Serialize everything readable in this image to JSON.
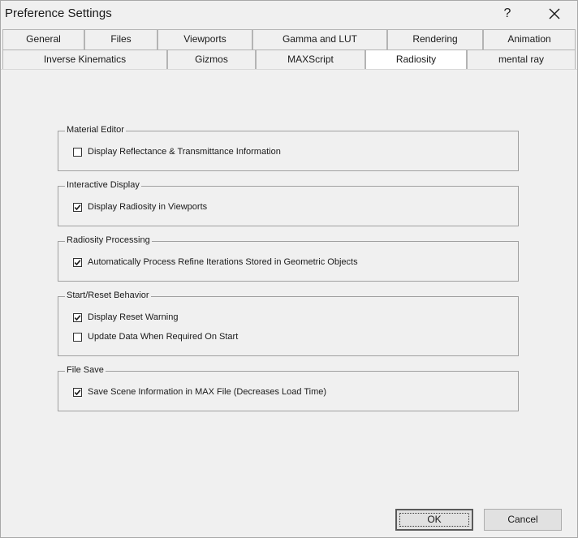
{
  "window": {
    "title": "Preference Settings",
    "help_label": "?"
  },
  "tabs": {
    "row1": [
      "General",
      "Files",
      "Viewports",
      "Gamma and LUT",
      "Rendering",
      "Animation"
    ],
    "row2": [
      "Inverse Kinematics",
      "Gizmos",
      "MAXScript",
      "Radiosity",
      "mental ray"
    ],
    "active": "Radiosity"
  },
  "groups": {
    "material_editor": {
      "label": "Material Editor",
      "options": [
        {
          "label": "Display Reflectance & Transmittance Information",
          "checked": false
        }
      ]
    },
    "interactive_display": {
      "label": "Interactive Display",
      "options": [
        {
          "label": "Display Radiosity in Viewports",
          "checked": true
        }
      ]
    },
    "radiosity_processing": {
      "label": "Radiosity Processing",
      "options": [
        {
          "label": "Automatically Process Refine Iterations Stored in Geometric Objects",
          "checked": true
        }
      ]
    },
    "start_reset": {
      "label": "Start/Reset Behavior",
      "options": [
        {
          "label": "Display Reset Warning",
          "checked": true
        },
        {
          "label": "Update Data When Required On Start",
          "checked": false
        }
      ]
    },
    "file_save": {
      "label": "File Save",
      "options": [
        {
          "label": "Save Scene Information in MAX File (Decreases Load Time)",
          "checked": true
        }
      ]
    }
  },
  "buttons": {
    "ok": "OK",
    "cancel": "Cancel"
  }
}
